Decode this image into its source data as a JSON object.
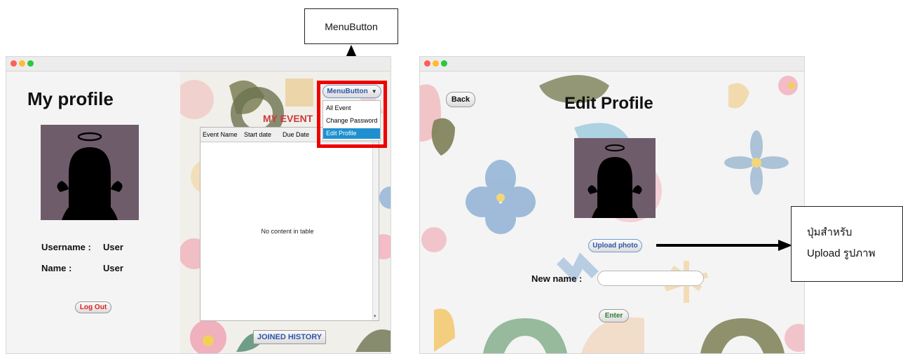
{
  "annotations": {
    "menubutton_label": "MenuButton",
    "upload_line1": "ปุ่มสำหรับ",
    "upload_line2": "Upload รูปภาพ"
  },
  "profile_window": {
    "title": "My profile",
    "username_label": "Username :",
    "username_value": "User",
    "name_label": "Name :",
    "name_value": "User",
    "logout_label": "Log Out",
    "event_title": "MY EVENT",
    "menu_button_label": "MenuButton",
    "menu_items": [
      "All Event",
      "Change Password",
      "Edit Profile"
    ],
    "selected_menu_item": "Edit Profile",
    "table_columns": [
      "Event Name",
      "Start date",
      "Due Date"
    ],
    "table_empty_text": "No content in table",
    "joined_history_label": "JOINED HISTORY"
  },
  "edit_window": {
    "back_label": "Back",
    "title": "Edit Profile",
    "upload_label": "Upload photo",
    "new_name_label": "New name :",
    "new_name_value": "",
    "enter_label": "Enter"
  },
  "colors": {
    "highlight_border": "#ee0000",
    "menu_selected": "#1e90d0",
    "event_title": "#cc3a3a",
    "logout_text": "#e02020",
    "blue_button_text": "#2f55a8",
    "enter_text": "#2e7d32",
    "avatar_bg": "#6f5c6b"
  }
}
